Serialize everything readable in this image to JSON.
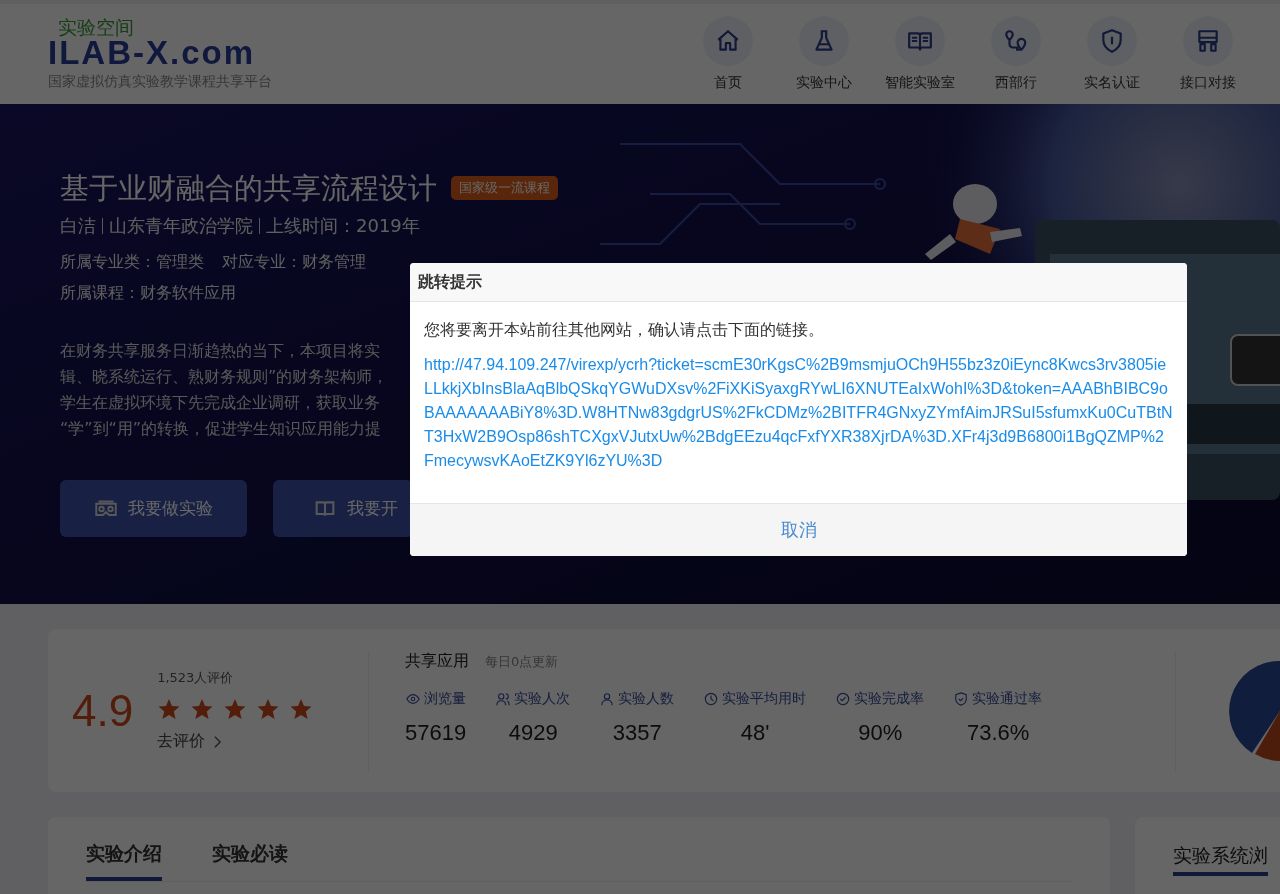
{
  "logo": {
    "cn": "实验空间",
    "en": "ILAB-X.com",
    "subtitle": "国家虚拟仿真实验教学课程共享平台"
  },
  "nav": [
    {
      "label": "首页",
      "kind": "home"
    },
    {
      "label": "实验中心",
      "kind": "flask"
    },
    {
      "label": "智能实验室",
      "kind": "book"
    },
    {
      "label": "西部行",
      "kind": "route"
    },
    {
      "label": "实名认证",
      "kind": "shield"
    },
    {
      "label": "接口对接",
      "kind": "network"
    }
  ],
  "course": {
    "title": "基于业财融合的共享流程设计",
    "badge": "国家级一流课程",
    "meta": [
      "白洁",
      "山东青年政治学院",
      "上线时间：2019年"
    ],
    "info_rows": [
      [
        "所属专业类：管理类",
        "对应专业：财务管理"
      ],
      [
        "所属课程：财务软件应用"
      ]
    ],
    "description": [
      "在财务共享服务日渐趋热的当下，本项目将实",
      "辑、晓系统运行、熟财务规则”的财务架构师，",
      "学生在虚拟环境下先完成企业调研，获取业务",
      "“学”到“用”的转换，促进学生知识应用能力提"
    ],
    "buttons": [
      {
        "label": "我要做实验",
        "kind": "vr"
      },
      {
        "label": "我要开",
        "kind": "book"
      }
    ]
  },
  "rating": {
    "score": "4.9",
    "count": "1,523人评价",
    "stars": 5,
    "link": "去评价"
  },
  "stats": {
    "title": "共享应用",
    "note": "每日0点更新",
    "items": [
      {
        "label": "浏览量",
        "value": "57619",
        "kind": "eye"
      },
      {
        "label": "实验人次",
        "value": "4929",
        "kind": "users"
      },
      {
        "label": "实验人数",
        "value": "3357",
        "kind": "user"
      },
      {
        "label": "实验平均用时",
        "value": "48'",
        "kind": "clock"
      },
      {
        "label": "实验完成率",
        "value": "90%",
        "kind": "check"
      },
      {
        "label": "实验通过率",
        "value": "73.6%",
        "kind": "shield"
      }
    ]
  },
  "tabs": [
    {
      "label": "实验介绍",
      "selected": true
    },
    {
      "label": "实验必读",
      "selected": false
    }
  ],
  "side_panel": {
    "title": "实验系统浏"
  },
  "dialog": {
    "title": "跳转提示",
    "message": "您将要离开本站前往其他网站，确认请点击下面的链接。",
    "link": "http://47.94.109.247/virexp/ycrh?ticket=scmE30rKgsC%2B9msmjuOCh9H55bz3z0iEync8Kwcs3rv3805ieLLkkjXbInsBlaAqBlbQSkqYGWuDXsv%2FiXKiSyaxgRYwLI6XNUTEaIxWohI%3D&token=AAABhBIBC9oBAAAAAAABiY8%3D.W8HTNw83gdgrUS%2FkCDMz%2BITFR4GNxyZYmfAimJRSuI5sfumxKu0CuTBtNT3HxW2B9Osp86shTCXgxVJutxUw%2BdgEEzu4qcFxfYXR38XjrDA%3D.XFr4j3d9B6800i1BgQZMP%2FmecywsvKAoEtZK9Yl6zYU%3D",
    "cancel": "取消"
  }
}
